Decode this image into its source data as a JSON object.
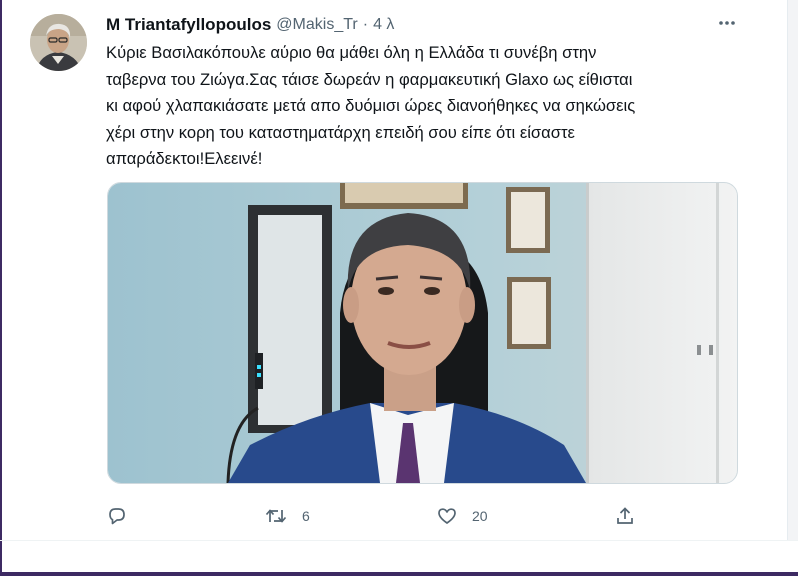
{
  "tweet": {
    "display_name": "M Triantafyllopoulos",
    "handle": "@Makis_Tr",
    "separator": "·",
    "time": "4 λ",
    "text": "Κύριε Βασιλακόπουλε αύριο θα μάθει όλη η Ελλάδα τι συνέβη στην\nταβερνα του Ζιώγα.Σας τάισε δωρεάν η φαρμακευτική Glaxo ως είθισται\nκι αφού χλαπακιάσατε μετά απο δυόμισι ώρες διανοήθηκες να σηκώσεις\nχέρι στην κορη του καταστηματάρχη επειδή σου είπε ότι είσαστε\nαπαράδεκτοι!Ελεεινέ!",
    "retweets": "6",
    "likes": "20"
  },
  "icons": {
    "more": "more-horizontal-icon",
    "reply": "reply-icon",
    "retweet": "retweet-icon",
    "like": "heart-icon",
    "share": "share-icon"
  },
  "colors": {
    "text": "#0f1419",
    "secondary": "#536471",
    "border": "#cfd9de"
  }
}
